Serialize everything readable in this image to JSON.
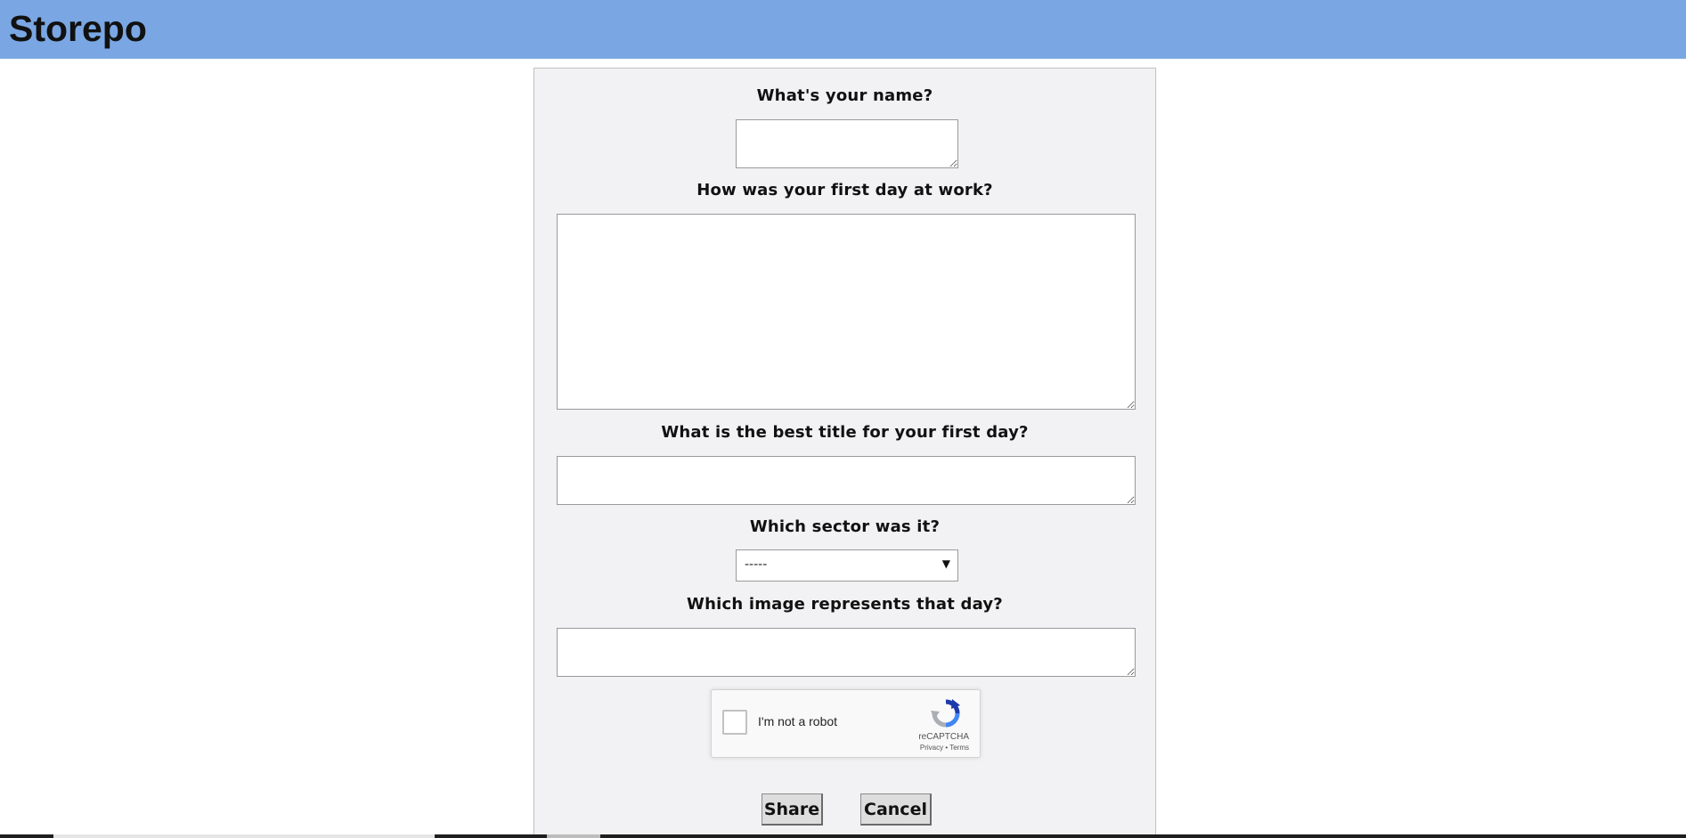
{
  "header": {
    "title": "Storepo",
    "background_color": "#7aa7e3"
  },
  "form": {
    "name_question": "What's your name?",
    "name_value": "",
    "story_question": "How was your first day at work?",
    "story_value": "",
    "title_question": "What is the best title for your first day?",
    "title_value": "",
    "sector_question": "Which sector was it?",
    "sector_selected": "-----",
    "image_question": "Which image represents that day?",
    "image_value": ""
  },
  "captcha": {
    "label": "I'm not a robot",
    "brand": "reCAPTCHA",
    "privacy": "Privacy",
    "separator": " • ",
    "terms": "Terms",
    "checked": false
  },
  "buttons": {
    "share": "Share",
    "cancel": "Cancel"
  },
  "colors": {
    "panel_background": "#f2f2f4",
    "button_background": "#dddddd"
  }
}
